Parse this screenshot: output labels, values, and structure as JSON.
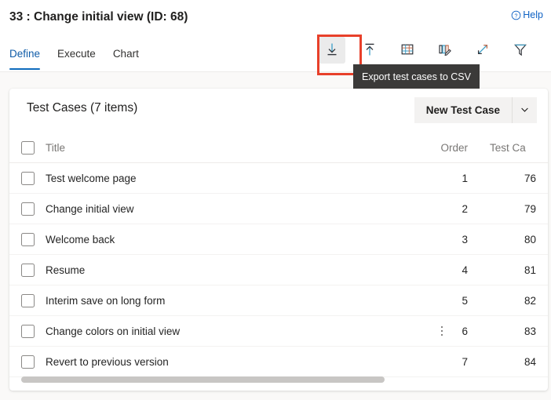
{
  "header": {
    "title": "33 : Change initial view (ID: 68)",
    "help_label": "Help",
    "help_icon": "question-circle-icon"
  },
  "command_bar": {
    "tabs": [
      {
        "label": "Define",
        "active": true
      },
      {
        "label": "Execute",
        "active": false
      },
      {
        "label": "Chart",
        "active": false
      }
    ],
    "tools": [
      {
        "name": "export-csv-button",
        "icon": "download-arrow-to-line-icon",
        "hovered": true,
        "highlighted": true
      },
      {
        "name": "import-csv-button",
        "icon": "upload-arrow-to-line-icon",
        "hovered": false,
        "highlighted": false
      },
      {
        "name": "grid-view-button",
        "icon": "table-grid-icon",
        "hovered": false,
        "highlighted": false
      },
      {
        "name": "bulk-edit-button",
        "icon": "columns-edit-pencil-icon",
        "hovered": false,
        "highlighted": false
      },
      {
        "name": "expand-view-button",
        "icon": "diagonal-expand-arrows-icon",
        "hovered": false,
        "highlighted": false
      },
      {
        "name": "filter-button",
        "icon": "funnel-filter-icon",
        "hovered": false,
        "highlighted": false
      }
    ],
    "tooltip": "Export test cases to CSV"
  },
  "card": {
    "title": "Test Cases (7 items)",
    "new_button_label": "New Test Case",
    "new_button_chevron_icon": "chevron-down-icon"
  },
  "table": {
    "columns": {
      "title": "Title",
      "order": "Order",
      "test_case_id": "Test Ca"
    },
    "rows": [
      {
        "title": "Test welcome page",
        "order": "1",
        "test_case_id": "76",
        "menu": false
      },
      {
        "title": "Change initial view",
        "order": "2",
        "test_case_id": "79",
        "menu": false
      },
      {
        "title": "Welcome back",
        "order": "3",
        "test_case_id": "80",
        "menu": false
      },
      {
        "title": "Resume",
        "order": "4",
        "test_case_id": "81",
        "menu": false
      },
      {
        "title": "Interim save on long form",
        "order": "5",
        "test_case_id": "82",
        "menu": false
      },
      {
        "title": "Change colors on initial view",
        "order": "6",
        "test_case_id": "83",
        "menu": true
      },
      {
        "title": "Revert to previous version",
        "order": "7",
        "test_case_id": "84",
        "menu": false
      }
    ]
  },
  "colors": {
    "accent": "#0f6cbd",
    "link": "#0f62c4",
    "annotation": "#e8402a",
    "tooltip_bg": "#3b3a39",
    "page_bg": "#faf9f8",
    "button_bg": "#f3f2f1",
    "scrollbar_thumb": "#c8c6c4"
  },
  "scrollbar": {
    "orientation": "horizontal",
    "name": "table-horizontal-scrollbar"
  }
}
